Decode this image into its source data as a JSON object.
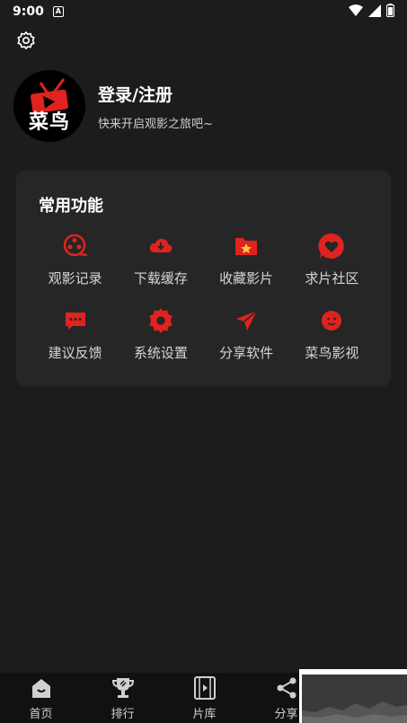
{
  "status": {
    "time": "9:00",
    "notif_glyph": "A"
  },
  "profile": {
    "avatar_text": "菜鸟",
    "login": "登录/注册",
    "subtitle": "快来开启观影之旅吧~"
  },
  "features": {
    "title": "常用功能",
    "items": [
      {
        "label": "观影记录",
        "icon": "film-reel-icon"
      },
      {
        "label": "下载缓存",
        "icon": "cloud-download-icon"
      },
      {
        "label": "收藏影片",
        "icon": "star-folder-icon"
      },
      {
        "label": "求片社区",
        "icon": "heart-chat-icon"
      },
      {
        "label": "建议反馈",
        "icon": "message-icon"
      },
      {
        "label": "系统设置",
        "icon": "gear-icon"
      },
      {
        "label": "分享软件",
        "icon": "send-icon"
      },
      {
        "label": "菜鸟影视",
        "icon": "bird-icon"
      }
    ]
  },
  "tabbar": {
    "tabs": [
      {
        "label": "首页",
        "icon": "home-icon"
      },
      {
        "label": "排行",
        "icon": "trophy-icon"
      },
      {
        "label": "片库",
        "icon": "film-icon"
      },
      {
        "label": "分享",
        "icon": "share-icon"
      }
    ]
  },
  "colors": {
    "accent": "#e0231f",
    "background": "#1c1c1c",
    "card": "#262626"
  }
}
